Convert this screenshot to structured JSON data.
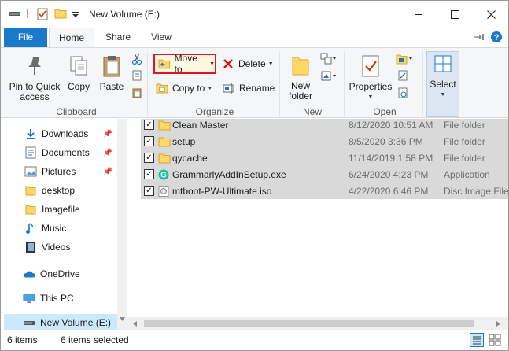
{
  "window": {
    "title": "New Volume (E:)",
    "controls": {
      "minimize": "—",
      "maximize": "☐",
      "close": "✕"
    }
  },
  "ribbon_tabs": [
    "File",
    "Home",
    "Share",
    "View"
  ],
  "ribbon": {
    "clipboard": {
      "group_label": "Clipboard",
      "pin_to_quick_access": "Pin to Quick access",
      "copy": "Copy",
      "paste": "Paste"
    },
    "organize": {
      "group_label": "Organize",
      "move_to": "Move to",
      "copy_to": "Copy to",
      "delete": "Delete",
      "rename": "Rename"
    },
    "new": {
      "group_label": "New",
      "new_folder": "New folder"
    },
    "open": {
      "group_label": "Open",
      "properties": "Properties"
    },
    "select": {
      "select": "Select"
    }
  },
  "nav": {
    "items": [
      {
        "label": "Downloads",
        "icon": "download-icon",
        "pinned": true
      },
      {
        "label": "Documents",
        "icon": "documents-icon",
        "pinned": true
      },
      {
        "label": "Pictures",
        "icon": "pictures-icon",
        "pinned": true
      },
      {
        "label": "desktop",
        "icon": "folder-icon",
        "pinned": false
      },
      {
        "label": "Imagefile",
        "icon": "folder-icon",
        "pinned": false
      },
      {
        "label": "Music",
        "icon": "music-icon",
        "pinned": false
      },
      {
        "label": "Videos",
        "icon": "videos-icon",
        "pinned": false
      },
      {
        "label": "OneDrive",
        "icon": "cloud-icon",
        "pinned": false
      },
      {
        "label": "This PC",
        "icon": "pc-icon",
        "pinned": false
      },
      {
        "label": "New Volume (E:)",
        "icon": "drive-icon",
        "pinned": false,
        "selected": true
      }
    ],
    "pin_glyph": "📌"
  },
  "files": [
    {
      "name": "Clean Master",
      "date": "8/12/2020 10:51 AM",
      "type": "File folder",
      "icon": "folder-icon",
      "checked": true
    },
    {
      "name": "setup",
      "date": "8/5/2020 3:36 PM",
      "type": "File folder",
      "icon": "folder-icon",
      "checked": true
    },
    {
      "name": "qycache",
      "date": "11/14/2019 1:58 PM",
      "type": "File folder",
      "icon": "folder-icon",
      "checked": true
    },
    {
      "name": "GrammarlyAddInSetup.exe",
      "date": "6/24/2020 4:23 PM",
      "type": "Application",
      "icon": "grammarly-icon",
      "checked": true
    },
    {
      "name": "mtboot-PW-Ultimate.iso",
      "date": "4/22/2020 6:46 PM",
      "type": "Disc Image File",
      "icon": "disc-image-icon",
      "checked": true
    }
  ],
  "checkmark": "✓",
  "status": {
    "items_count": "6 items",
    "selected_count": "6 items selected"
  },
  "colors": {
    "file_tab": "#1979ca",
    "highlight_border": "#e81123",
    "selection": "#d9d9d9",
    "folder": "#ffd767"
  }
}
